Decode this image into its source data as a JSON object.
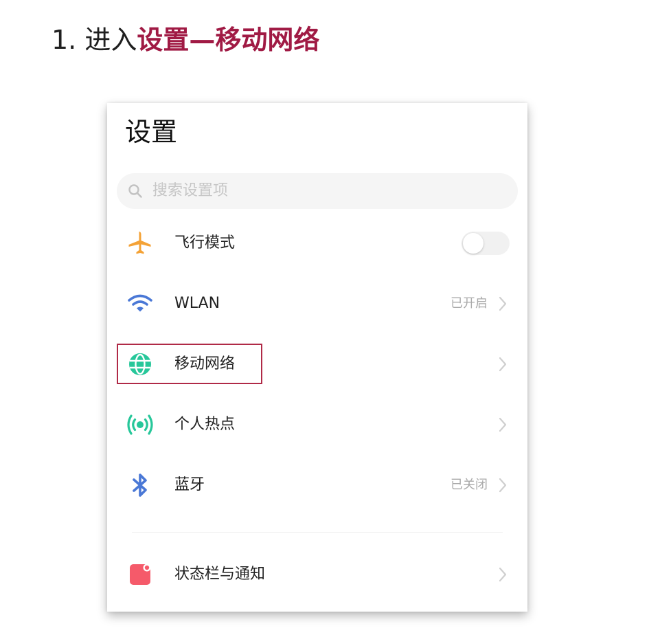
{
  "heading": {
    "step": "1. 进入",
    "emphasis": "设置—移动网络"
  },
  "settings": {
    "title": "设置",
    "search": {
      "placeholder": "搜索设置项",
      "icon": "search-icon"
    },
    "items": [
      {
        "label": "飞行模式",
        "icon": "airplane-icon",
        "toggle": false
      },
      {
        "label": "WLAN",
        "icon": "wifi-icon",
        "status": "已开启"
      },
      {
        "label": "移动网络",
        "icon": "globe-icon",
        "highlighted": true
      },
      {
        "label": "个人热点",
        "icon": "hotspot-icon"
      },
      {
        "label": "蓝牙",
        "icon": "bluetooth-icon",
        "status": "已关闭"
      },
      {
        "label": "状态栏与通知",
        "icon": "notification-icon"
      }
    ]
  },
  "colors": {
    "accent": "#a01a44",
    "highlight_border": "#b02a47",
    "airplane": "#f4a236",
    "wifi": "#4a78d6",
    "globe": "#27c79a",
    "hotspot": "#27c79a",
    "bluetooth": "#4a78d6",
    "notification": "#f55a6a"
  }
}
